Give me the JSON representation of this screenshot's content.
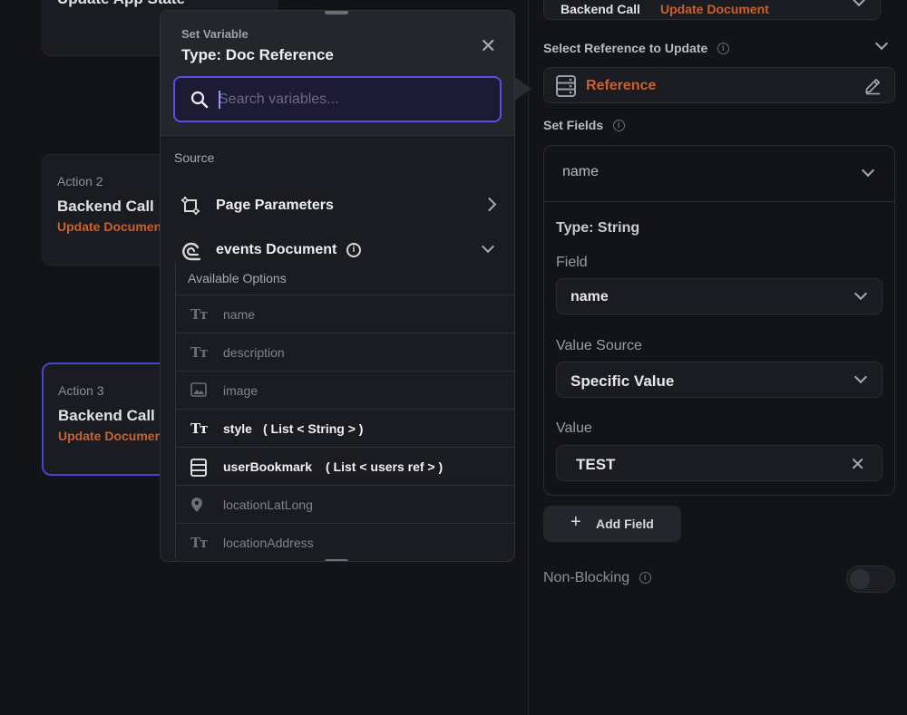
{
  "canvas": {
    "top_card": {
      "title": "Update App State"
    },
    "action2": {
      "label": "Action 2",
      "title": "Backend Call",
      "subtitle": "Update Document"
    },
    "action3": {
      "label": "Action 3",
      "title": "Backend Call",
      "subtitle": "Update Document"
    }
  },
  "panel": {
    "top_dropdown": {
      "type": "Backend Call",
      "action": "Update Document"
    },
    "reference_section": {
      "label": "Select Reference to Update",
      "value": "Reference"
    },
    "set_fields_label": "Set Fields",
    "field_card": {
      "header": "name",
      "type_label": "Type: String",
      "field_label": "Field",
      "field_value": "name",
      "value_source_label": "Value Source",
      "value_source": "Specific Value",
      "value_label": "Value",
      "value": "TEST"
    },
    "add_field_label": "Add Field",
    "non_blocking_label": "Non-Blocking",
    "non_blocking": false
  },
  "popup": {
    "caption": "Set Variable",
    "title": "Type: Doc Reference",
    "search_placeholder": "Search variables...",
    "source_label": "Source",
    "sources": [
      {
        "label": "Page Parameters",
        "icon": "page-parameters-icon"
      },
      {
        "label": "events Document",
        "icon": "firestore-document-icon"
      }
    ],
    "options_header": "Available Options",
    "options": [
      {
        "label": "name",
        "icon": "text-icon",
        "enabled": false
      },
      {
        "label": "description",
        "icon": "text-icon",
        "enabled": false
      },
      {
        "label": "image",
        "icon": "image-icon",
        "enabled": false
      },
      {
        "label": "style",
        "type_hint": "( List < String > )",
        "icon": "text-icon",
        "enabled": true
      },
      {
        "label": "userBookmark",
        "type_hint": "( List < users ref > )",
        "icon": "reference-icon",
        "enabled": true
      },
      {
        "label": "locationLatLong",
        "icon": "location-pin-icon",
        "enabled": false
      },
      {
        "label": "locationAddress",
        "icon": "text-icon",
        "enabled": false
      }
    ]
  },
  "colors": {
    "background": "#131418",
    "accent": "#5a4fe3",
    "orange": "#c9622f"
  }
}
